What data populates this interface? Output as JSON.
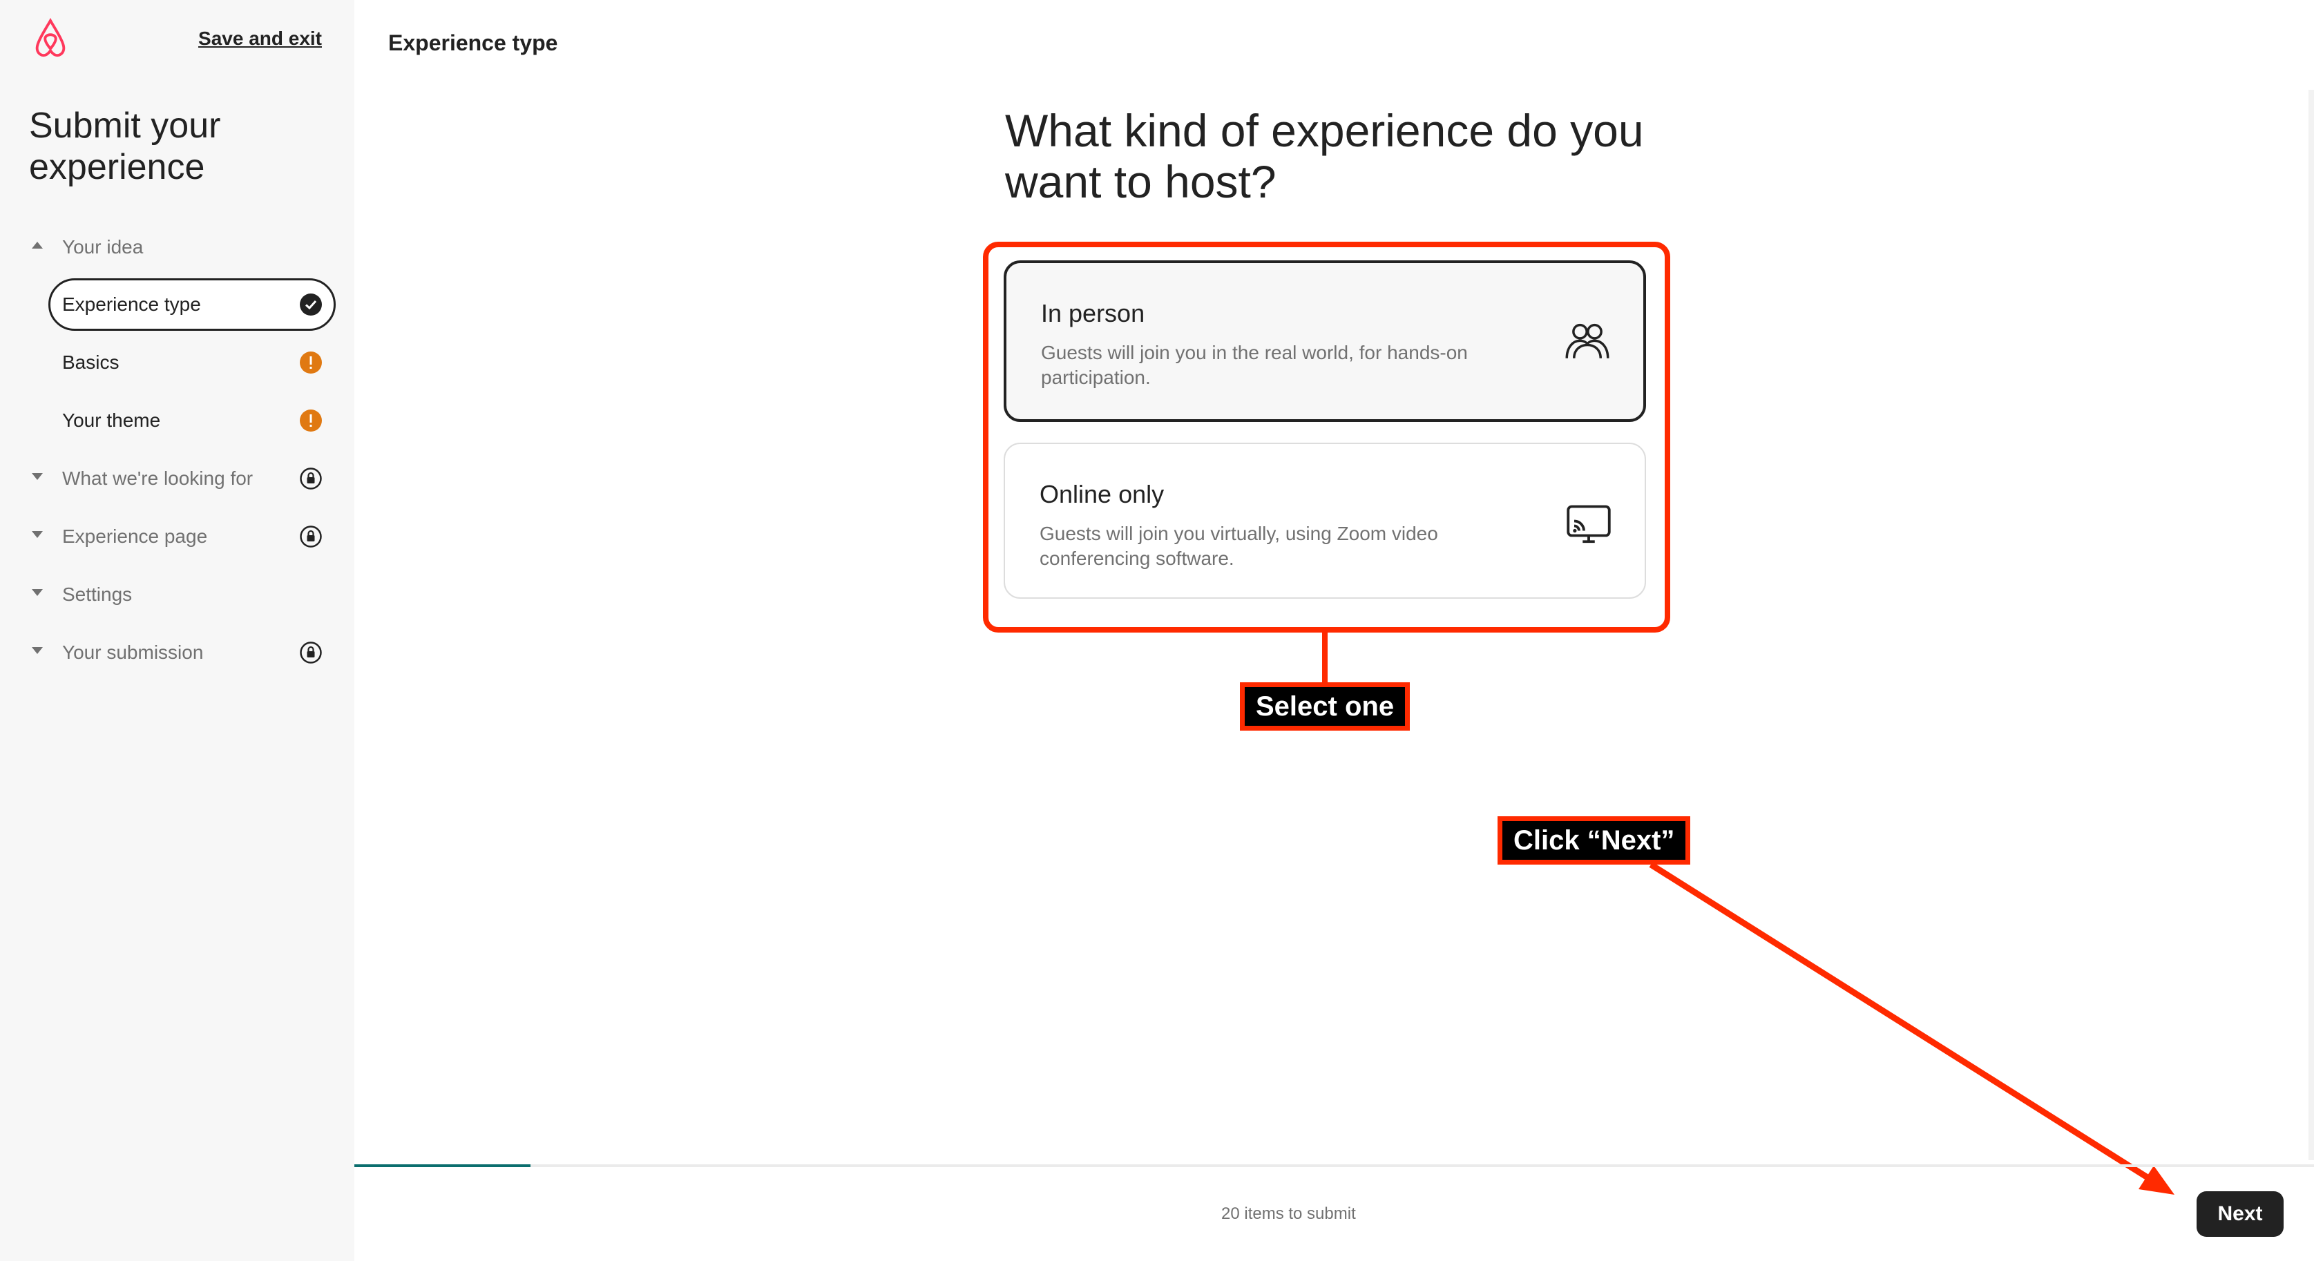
{
  "sidebar": {
    "save_exit": "Save and exit",
    "title": "Submit your experience",
    "nav": [
      {
        "label": "Your idea",
        "chevron": "chevron-up-icon",
        "status": null
      },
      {
        "label": "Experience type",
        "status": "checkmark-icon",
        "selected": true
      },
      {
        "label": "Basics",
        "status": "warning-icon"
      },
      {
        "label": "Your theme",
        "status": "warning-icon"
      },
      {
        "label": "What we're looking for",
        "chevron": "chevron-down-icon",
        "status": "lock-icon"
      },
      {
        "label": "Experience page",
        "chevron": "chevron-down-icon",
        "status": "lock-icon"
      },
      {
        "label": "Settings",
        "chevron": "chevron-down-icon",
        "status": null
      },
      {
        "label": "Your submission",
        "chevron": "chevron-down-icon",
        "status": "lock-icon"
      }
    ]
  },
  "main": {
    "header": "Experience type",
    "question": "What kind of experience do you want to host?",
    "options": [
      {
        "title": "In person",
        "description": "Guests will join you in the real world, for hands-on participation.",
        "icon": "people-icon",
        "selected": true
      },
      {
        "title": "Online only",
        "description": "Guests will join you virtually, using Zoom video conferencing software.",
        "icon": "cast-screen-icon",
        "selected": false
      }
    ]
  },
  "annotations": {
    "select_one": "Select one",
    "click_next": "Click “Next”"
  },
  "footer": {
    "items_to_submit": "20 items to submit",
    "next_label": "Next",
    "progress_fraction": 0.09
  },
  "colors": {
    "accent_red": "#ff2a00",
    "warning": "#e07912",
    "progress": "#0b6e6e"
  }
}
